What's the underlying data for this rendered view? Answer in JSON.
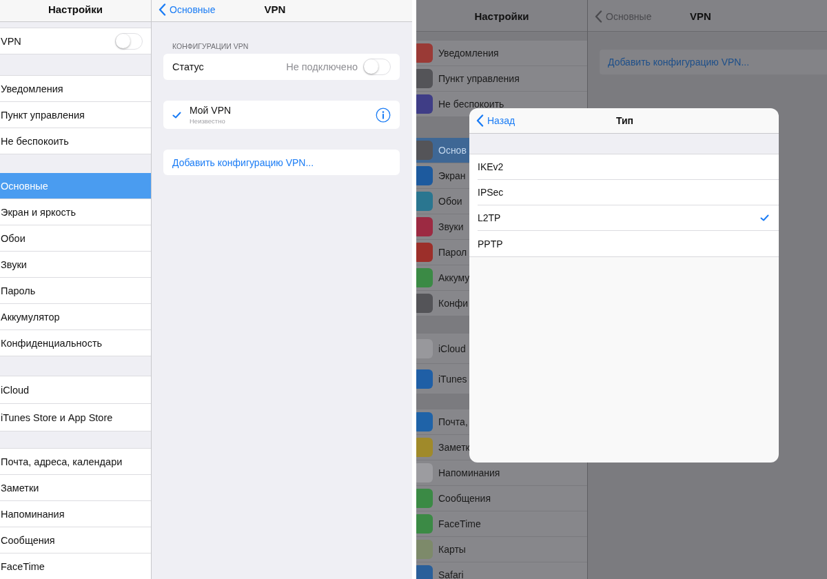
{
  "left": {
    "sidebar": {
      "title": "Настройки",
      "groups": [
        [
          {
            "label": "VPN",
            "kind": "toggle",
            "on": false,
            "selected": false
          }
        ],
        [
          {
            "label": "Уведомления",
            "kind": "link",
            "selected": false
          },
          {
            "label": "Пункт управления",
            "kind": "link",
            "selected": false
          },
          {
            "label": "Не беспокоить",
            "kind": "link",
            "selected": false
          }
        ],
        [
          {
            "label": "Основные",
            "kind": "link",
            "selected": true
          },
          {
            "label": "Экран и яркость",
            "kind": "link",
            "selected": false
          },
          {
            "label": "Обои",
            "kind": "link",
            "selected": false
          },
          {
            "label": "Звуки",
            "kind": "link",
            "selected": false
          },
          {
            "label": "Пароль",
            "kind": "link",
            "selected": false
          },
          {
            "label": "Аккумулятор",
            "kind": "link",
            "selected": false
          },
          {
            "label": "Конфиденциальность",
            "kind": "link",
            "selected": false
          }
        ],
        [
          {
            "label": "iCloud",
            "kind": "link",
            "selected": false
          },
          {
            "label": "iTunes Store и App Store",
            "kind": "link",
            "selected": false
          }
        ],
        [
          {
            "label": "Почта, адреса, календари",
            "kind": "link",
            "selected": false
          },
          {
            "label": "Заметки",
            "kind": "link",
            "selected": false
          },
          {
            "label": "Напоминания",
            "kind": "link",
            "selected": false
          },
          {
            "label": "Сообщения",
            "kind": "link",
            "selected": false
          },
          {
            "label": "FaceTime",
            "kind": "link",
            "selected": false
          }
        ]
      ]
    },
    "detail": {
      "back": "Основные",
      "title": "VPN",
      "section_header": "КОНФИГУРАЦИИ VPN",
      "status": {
        "label": "Статус",
        "value": "Не подключено",
        "on": false
      },
      "configs": [
        {
          "name": "Мой VPN",
          "status": "Неизвестно",
          "selected": true
        }
      ],
      "add_link": "Добавить конфигурацию VPN..."
    }
  },
  "right": {
    "sidebar": {
      "title": "Настройки",
      "groups": [
        [
          {
            "label": "Уведомления",
            "color": "#9a3a36",
            "selected": false
          },
          {
            "label": "Пункт управления",
            "color": "#545458",
            "selected": false
          },
          {
            "label": "Не беспокоить",
            "color": "#3f3d86",
            "selected": false
          }
        ],
        [
          {
            "label": "Основ",
            "color": "#545458",
            "selected": true
          },
          {
            "label": "Экран",
            "color": "#1d5a9e",
            "selected": false
          },
          {
            "label": "Обои",
            "color": "#2a7690",
            "selected": false
          },
          {
            "label": "Звуки",
            "color": "#9c2a42",
            "selected": false
          },
          {
            "label": "Парол",
            "color": "#9c2f2a",
            "selected": false
          },
          {
            "label": "Аккуму",
            "color": "#3b8a45",
            "selected": false
          },
          {
            "label": "Конфи",
            "color": "#545458",
            "selected": false
          }
        ],
        [
          {
            "label": "iCloud",
            "color": "#98989c",
            "selected": false
          },
          {
            "label": "iTunes",
            "color": "#1f5fa6",
            "selected": false
          }
        ],
        [
          {
            "label": "Почта,",
            "color": "#1f63a8",
            "selected": false
          },
          {
            "label": "Заметк",
            "color": "#a08a2a",
            "selected": false
          },
          {
            "label": "Напоминания",
            "color": "#9c9ca0",
            "selected": false
          },
          {
            "label": "Сообщения",
            "color": "#3b8a45",
            "selected": false
          },
          {
            "label": "FaceTime",
            "color": "#3b8a45",
            "selected": false
          },
          {
            "label": "Карты",
            "color": "#7d8a6a",
            "selected": false
          },
          {
            "label": "Safari",
            "color": "#2a5f9a",
            "selected": false
          }
        ]
      ]
    },
    "detail": {
      "back": "Основные",
      "title": "VPN",
      "add_link": "Добавить конфигурацию VPN..."
    },
    "modal": {
      "back": "Назад",
      "title": "Тип",
      "options": [
        {
          "label": "IKEv2",
          "selected": false
        },
        {
          "label": "IPSec",
          "selected": false
        },
        {
          "label": "L2TP",
          "selected": true
        },
        {
          "label": "PPTP",
          "selected": false
        }
      ]
    }
  }
}
